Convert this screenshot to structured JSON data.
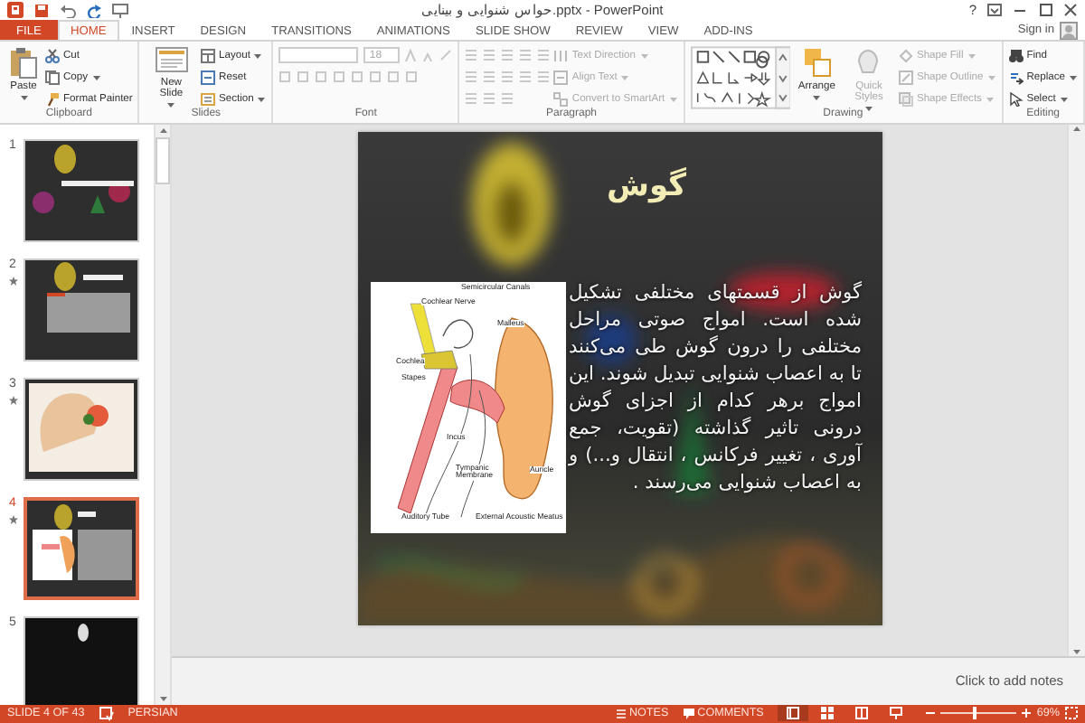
{
  "title_bar": {
    "title": "حواس شنوایی و بینایی.pptx - PowerPoint",
    "help": "?"
  },
  "tabs": [
    {
      "label": "FILE",
      "kind": "file",
      "selected": false
    },
    {
      "label": "HOME",
      "kind": "tab",
      "selected": true
    },
    {
      "label": "INSERT",
      "kind": "tab",
      "selected": false
    },
    {
      "label": "DESIGN",
      "kind": "tab",
      "selected": false
    },
    {
      "label": "TRANSITIONS",
      "kind": "tab",
      "selected": false
    },
    {
      "label": "ANIMATIONS",
      "kind": "tab",
      "selected": false
    },
    {
      "label": "SLIDE SHOW",
      "kind": "tab",
      "selected": false
    },
    {
      "label": "REVIEW",
      "kind": "tab",
      "selected": false
    },
    {
      "label": "VIEW",
      "kind": "tab",
      "selected": false
    },
    {
      "label": "ADD-INS",
      "kind": "tab",
      "selected": false
    }
  ],
  "account": {
    "label": "Sign in"
  },
  "ribbon": [
    {
      "label": "Clipboard",
      "items": [
        {
          "kind": "large",
          "label": "Paste",
          "disabled": false,
          "dropdown": true
        },
        {
          "kind": "small",
          "label": "Cut",
          "disabled": false,
          "dropdown": false
        },
        {
          "kind": "small",
          "label": "Copy",
          "disabled": false,
          "dropdown": true
        },
        {
          "kind": "small",
          "label": "Format Painter",
          "disabled": false,
          "dropdown": false
        }
      ]
    },
    {
      "label": "Slides",
      "items": [
        {
          "kind": "large",
          "label": "New Slide",
          "disabled": false,
          "dropdown": true
        },
        {
          "kind": "small",
          "label": "Layout",
          "disabled": false,
          "dropdown": true
        },
        {
          "kind": "small",
          "label": "Reset",
          "disabled": false,
          "dropdown": false
        },
        {
          "kind": "small",
          "label": "Section",
          "disabled": false,
          "dropdown": true
        }
      ]
    },
    {
      "label": "Font",
      "items": [
        {
          "kind": "font-fields",
          "value": "18",
          "disabled": true
        }
      ]
    },
    {
      "label": "Paragraph",
      "items": [
        {
          "kind": "paragraph-icons",
          "disabled": true
        },
        {
          "kind": "small",
          "label": "Text Direction",
          "disabled": true,
          "dropdown": true
        },
        {
          "kind": "small",
          "label": "Align Text",
          "disabled": true,
          "dropdown": true
        },
        {
          "kind": "small",
          "label": "Convert to SmartArt",
          "disabled": true,
          "dropdown": true
        }
      ]
    },
    {
      "label": "Drawing",
      "items": [
        {
          "kind": "shapes",
          "disabled": false
        },
        {
          "kind": "large",
          "label": "Arrange",
          "disabled": false,
          "dropdown": true
        },
        {
          "kind": "large",
          "label": "Quick Styles",
          "disabled": true,
          "dropdown": true
        },
        {
          "kind": "small",
          "label": "Shape Fill",
          "disabled": true,
          "dropdown": true
        },
        {
          "kind": "small",
          "label": "Shape Outline",
          "disabled": true,
          "dropdown": true
        },
        {
          "kind": "small",
          "label": "Shape Effects",
          "disabled": true,
          "dropdown": true
        }
      ]
    },
    {
      "label": "Editing",
      "items": [
        {
          "kind": "small",
          "label": "Find",
          "disabled": false,
          "dropdown": false
        },
        {
          "kind": "small",
          "label": "Replace",
          "disabled": false,
          "dropdown": true
        },
        {
          "kind": "small",
          "label": "Select",
          "disabled": false,
          "dropdown": true
        }
      ]
    }
  ],
  "slides_pane": {
    "thumbnails": [
      {
        "number": "1",
        "kind": "title",
        "selected": false,
        "animated": false
      },
      {
        "number": "2",
        "kind": "text",
        "selected": false,
        "animated": true
      },
      {
        "number": "3",
        "kind": "diagram",
        "selected": false,
        "animated": true
      },
      {
        "number": "4",
        "kind": "text-diagram",
        "selected": true,
        "animated": true
      },
      {
        "number": "5",
        "kind": "photo",
        "selected": false,
        "animated": false
      }
    ]
  },
  "slide": {
    "title": "گوش",
    "body": "گوش از قسمتهای مختلفی تشکیل شده است. امواج صوتی مراحل مختلفی را درون گوش طی می‌کنند تا به اعصاب شنوایی تبدیل شوند. این امواج برهر کدام از اجزای گوش درونی تاثیر گذاشته (تقویت، جمع آوری ، تغییر فرکانس ، انتقال و...) و به اعصاب شنوایی می‌رسند .",
    "diagram_labels": [
      "Semicircular Canals",
      "Cochlear Nerve",
      "Malleus",
      "Cochlea",
      "Stapes",
      "Incus",
      "Tympanic Membrane",
      "Auricle",
      "Auditory Tube",
      "External Acoustic Meatus"
    ]
  },
  "notes": {
    "placeholder": "Click to add notes"
  },
  "status_bar": {
    "slide_info": "SLIDE 4 OF 43",
    "language": "PERSIAN",
    "notes": "NOTES",
    "comments": "COMMENTS",
    "views": [
      {
        "kind": "normal",
        "selected": true
      },
      {
        "kind": "sorter",
        "selected": false
      },
      {
        "kind": "reading",
        "selected": false
      },
      {
        "kind": "slideshow",
        "selected": false
      }
    ],
    "zoom": {
      "level": 0.45,
      "reading": "69%"
    }
  }
}
